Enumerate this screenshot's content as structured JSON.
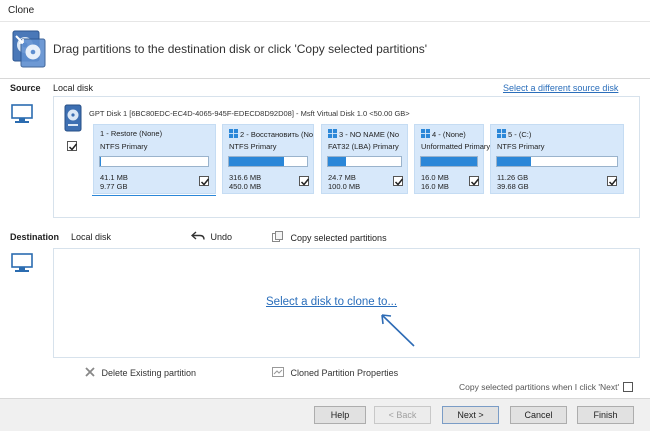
{
  "window": {
    "title": "Clone"
  },
  "header": {
    "text": "Drag partitions to the destination disk or click 'Copy selected partitions'"
  },
  "source": {
    "label": "Source",
    "disk_label": "Local disk",
    "change_link": "Select a different source disk",
    "disk_info": "GPT Disk 1 [6BC80EDC-EC4D-4065-945F-EDECD8D92D08] - Msft    Virtual Disk    1.0  <50.00 GB>",
    "disk_checked": true,
    "partitions": [
      {
        "label": "1 - Restore (None)",
        "type": "NTFS Primary",
        "used": "41.1 MB",
        "total": "9.77 GB",
        "fill": 0.004,
        "windows_icon": false,
        "checked": true
      },
      {
        "label": "2 - Восстановить (No",
        "type": "NTFS Primary",
        "used": "316.6 MB",
        "total": "450.0 MB",
        "fill": 0.7,
        "windows_icon": true,
        "checked": true
      },
      {
        "label": "3 - NO NAME (No",
        "type": "FAT32 (LBA) Primary",
        "used": "24.7 MB",
        "total": "100.0 MB",
        "fill": 0.25,
        "windows_icon": true,
        "checked": true
      },
      {
        "label": "4 - (None)",
        "type": "Unformatted Primary",
        "used": "16.0 MB",
        "total": "16.0 MB",
        "fill": 1.0,
        "windows_icon": true,
        "checked": true
      },
      {
        "label": "5 - (C:)",
        "type": "NTFS Primary",
        "used": "11.26 GB",
        "total": "39.68 GB",
        "fill": 0.28,
        "windows_icon": true,
        "checked": true
      }
    ]
  },
  "destination": {
    "label": "Destination",
    "disk_label": "Local disk",
    "undo_label": "Undo",
    "copy_label": "Copy selected partitions",
    "select_link": "Select a disk to clone to..."
  },
  "actions": {
    "delete_label": "Delete Existing partition",
    "properties_label": "Cloned Partition Properties",
    "copy_on_next": "Copy selected partitions when I click 'Next'",
    "copy_on_next_checked": false
  },
  "buttons": {
    "help": "Help",
    "back": "< Back",
    "next": "Next >",
    "cancel": "Cancel",
    "finish": "Finish"
  },
  "colors": {
    "accent": "#2b87d8",
    "partition_bg": "#d7e8fa",
    "link": "#2a6ebb"
  }
}
